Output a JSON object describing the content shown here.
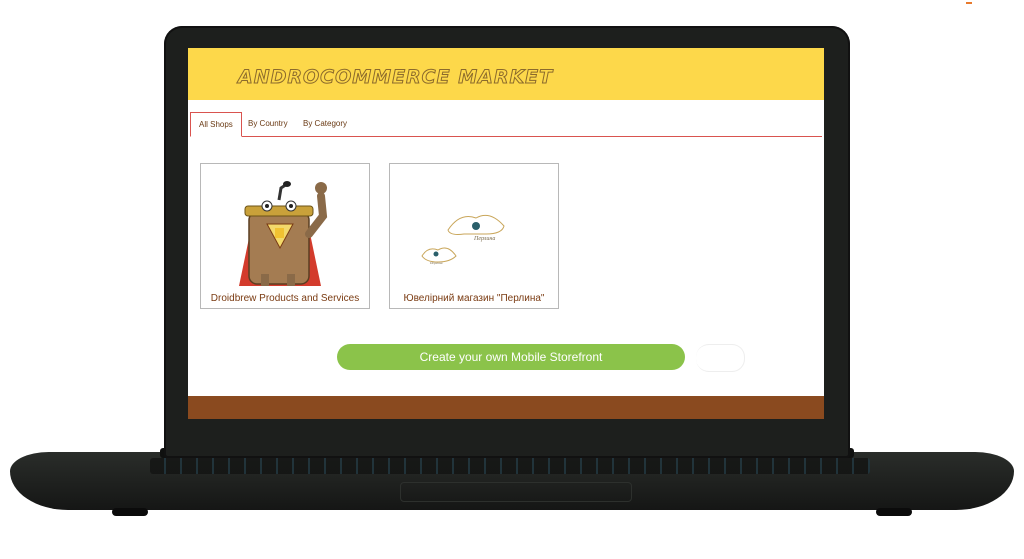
{
  "app": {
    "logo_text": "ANDROCOMMERCE MARKET"
  },
  "tabs": [
    {
      "label": "All Shops",
      "active": true
    },
    {
      "label": "By Country",
      "active": false
    },
    {
      "label": "By Category",
      "active": false
    }
  ],
  "shops": [
    {
      "title": "Droidbrew Products and Services",
      "image": "droidbrew-mascot-icon"
    },
    {
      "title": "Ювелірний магазин \"Перлина\"",
      "image": "perlyna-logo-icon",
      "logo_text": "Перлина"
    }
  ],
  "cta": {
    "label": "Create your own Mobile Storefront"
  },
  "colors": {
    "header": "#fdd84a",
    "tab_accent": "#d9534f",
    "cta": "#8bc34a",
    "footer": "#8a4a1f",
    "bezel": "#1d1f1d"
  }
}
